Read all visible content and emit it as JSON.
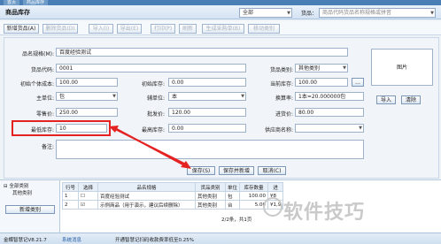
{
  "top_strip": {
    "tab1": "首页",
    "tab2": "商品库存"
  },
  "title": "商品库存",
  "filter": {
    "category": "全部",
    "goods_label": "货品：",
    "goods_placeholder": "商品代码货品名称规格或拼音"
  },
  "toolbar": {
    "add": "新增货品(A)",
    "delete": "删除货品(D)",
    "import": "导入(I)",
    "export": "导出(E)",
    "print": "打印(P)",
    "refresh": "刷新",
    "gen_purchase": "生成采购单(B)",
    "move": "移动类别"
  },
  "form": {
    "goods_name": {
      "label": "品名规格(M):",
      "value": "百度经验测试"
    },
    "goods_code": {
      "label": "货品代码:",
      "value": "0001"
    },
    "initial_unit_cost": {
      "label": "初始个体成本:",
      "value": "100.00"
    },
    "main_unit": {
      "label": "主单位:",
      "value": "包"
    },
    "retail_price": {
      "label": "零售价:",
      "value": "250.00"
    },
    "min_stock": {
      "label": "最低库存:",
      "value": "10"
    },
    "remark": {
      "label": "备注:",
      "value": ""
    },
    "initial_stock": {
      "label": "初始库存:",
      "value": "0.00"
    },
    "aux_unit": {
      "label": "辅单位:",
      "value": "本"
    },
    "wholesale_price": {
      "label": "批发价:",
      "value": "120.00"
    },
    "max_stock": {
      "label": "最高库存:",
      "value": "0.00"
    },
    "category": {
      "label": "货品类别:",
      "value": "其他类别"
    },
    "current_stock": {
      "label": "当前库存:",
      "value": "100.00"
    },
    "conversion": {
      "label": "换算率:",
      "value": "1本=20.000000包"
    },
    "purchase_price": {
      "label": "进货价:",
      "value": "80.00"
    },
    "supplier": {
      "label": "供应商名称:",
      "value": ""
    },
    "picture_label": "图片",
    "import_btn": "导入",
    "clear_btn": "清除",
    "save_btn": "保存(S)",
    "save_new_btn": "保存并新增",
    "cancel_btn": "取消(C)"
  },
  "tree": {
    "root": "全部类别",
    "child": "其他类别",
    "add_cat_btn": "新增类别"
  },
  "table": {
    "headers": [
      "行号",
      "选择",
      "品名规格",
      "货品类别",
      "单位",
      "库存数量",
      "进"
    ],
    "rows": [
      {
        "no": "1",
        "checked": false,
        "name": "百度经验测试",
        "cat": "其他类别",
        "unit": "包",
        "qty": "100.00",
        "in": "¥8"
      },
      {
        "no": "2",
        "checked": true,
        "name": "示例商品（用于演示，建议后续删除）",
        "cat": "其他类别",
        "unit": "台",
        "qty": "5.00",
        "in": "¥1,9"
      }
    ],
    "summary": "2/2条，共1页"
  },
  "status": {
    "version": "金蝶智慧记V8.21.7",
    "link": "系统消息",
    "message": "开通智慧记扫码收款费率低至0.25%"
  },
  "watermark": "软件技巧",
  "colors": {
    "highlight": "#e52222",
    "titlebar": "#d4e3f3"
  }
}
